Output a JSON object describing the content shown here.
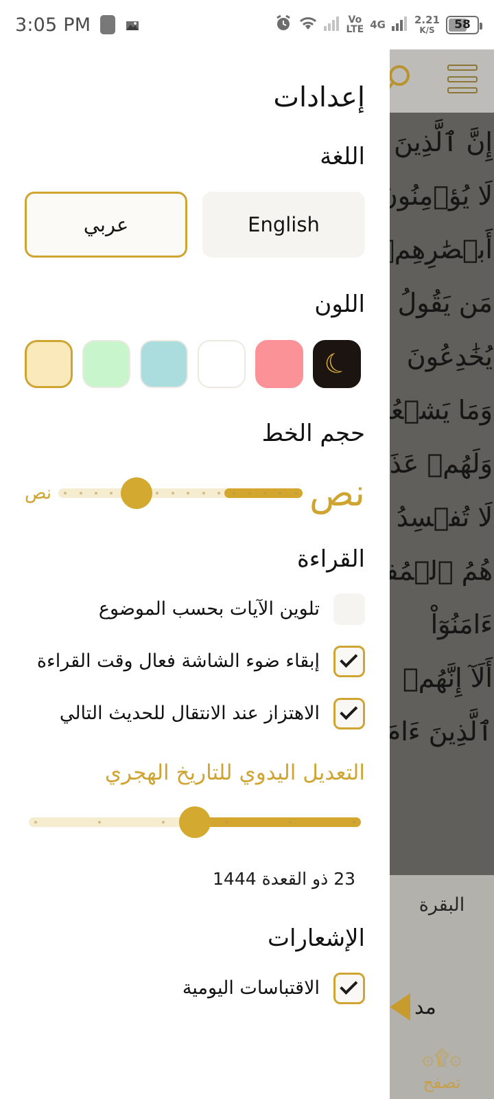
{
  "status_bar": {
    "time": "3:05 PM",
    "icons_left": [
      "screenshot-square-icon",
      "app-badge-icon"
    ],
    "alarm_icon": "alarm-clock-icon",
    "wifi_icon": "wifi-icon",
    "signal1_icon": "signal-bars-icon",
    "volte_line1": "Vo",
    "volte_line2": "LTE",
    "network_type": "4G",
    "signal2_icon": "signal-bars-icon",
    "data_speed_value": "2.21",
    "data_speed_unit": "K/S",
    "battery_percent": "58"
  },
  "settings": {
    "page_title": "إعدادات",
    "language": {
      "section_title": "اللغة",
      "options": [
        {
          "label": "English",
          "selected": false
        },
        {
          "label": "عربي",
          "selected": true
        }
      ]
    },
    "color": {
      "section_title": "اللون",
      "swatches": [
        {
          "name": "cream",
          "hex": "#FAEABB",
          "selected": true,
          "icon": null
        },
        {
          "name": "mint",
          "hex": "#C8F5CC",
          "selected": false,
          "icon": null
        },
        {
          "name": "aqua",
          "hex": "#ABDCDE",
          "selected": false,
          "icon": null
        },
        {
          "name": "white",
          "hex": "#FFFFFF",
          "selected": false,
          "icon": null
        },
        {
          "name": "pink",
          "hex": "#FB9297",
          "selected": false,
          "icon": null
        },
        {
          "name": "dark-mode",
          "hex": "#1C1410",
          "selected": false,
          "icon": "crescent-moon-icon"
        }
      ]
    },
    "font_size": {
      "section_title": "حجم الخط",
      "small_label": "نص",
      "large_label": "نص",
      "value_percent": 68
    },
    "reading": {
      "section_title": "القراءة",
      "items": [
        {
          "label": "تلوين الآيات بحسب الموضوع",
          "checked": false
        },
        {
          "label": "إبقاء ضوء الشاشة فعال وقت القراءة",
          "checked": true
        },
        {
          "label": "الاهتزاز عند الانتقال للحديث التالي",
          "checked": true
        }
      ]
    },
    "hijri": {
      "title": "التعديل اليدوي للتاريخ الهجري",
      "value_percent": 50,
      "date_text": "23 ذو القعدة 1444"
    },
    "notifications": {
      "section_title": "الإشعارات",
      "items": [
        {
          "label": "الاقتباسات اليومية",
          "checked": true
        }
      ]
    }
  },
  "reader": {
    "search_icon": "search-icon",
    "menu_icon": "hamburger-menu-icon",
    "ayah_lines": [
      "إِنَّ ٱلَّذِينَ",
      "لَا يُؤۡمِنُونَ",
      "أَبۡصَٰرِهِمۡ",
      "مَن يَقُولُ",
      "يُخَٰدِعُونَ",
      "وَمَا يَشۡعُرُ",
      "وَلَهُمۡ عَذَ",
      "لَا تُفۡسِدُ",
      "هُمُ ٱلۡمُفۡسِ",
      "ءَامَنُوٓاْ",
      "أَلَآ إِنَّهُمۡ",
      "ٱلَّذِينَ ءَامَ"
    ],
    "surah_name": "البقرة",
    "play_icon": "play-icon",
    "play_label": "مد",
    "browse_glyph": "quran-seal-icon",
    "browse_label": "تصفح"
  },
  "colors": {
    "gold": "#cfa431",
    "gold_fill": "#d3a72f",
    "track_light": "#f6ecd0",
    "button_bg": "#f6f4f0",
    "text_dark": "#121212"
  }
}
